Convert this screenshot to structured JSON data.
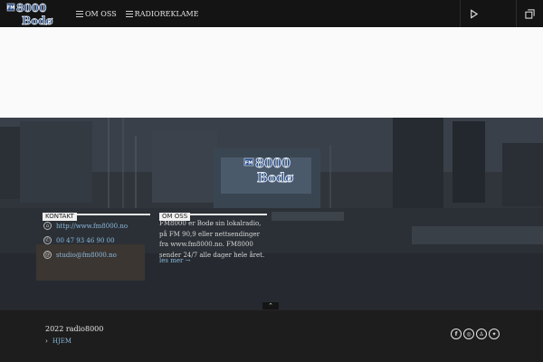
{
  "header": {
    "logo_top": "FM 8000",
    "logo_bottom": "Bodø",
    "nav": [
      {
        "label": "OM OSS"
      },
      {
        "label": "RADIOREKLAME"
      }
    ]
  },
  "hero": {
    "logo_top": "8000",
    "logo_bottom": "Bodø",
    "logo_badge": "FM",
    "contact_title": "KONTAKT",
    "contact": [
      {
        "icon": "home-icon",
        "glyph": "⌂",
        "text": "http://www.fm8000.no"
      },
      {
        "icon": "phone-icon",
        "glyph": "✆",
        "text": "00 47 93 46 90 00"
      },
      {
        "icon": "at-icon",
        "glyph": "@",
        "text": "studio@fm8000.no"
      }
    ],
    "about_title": "OM OSS",
    "about_text": "FM8000 er Bodø sin lokalradio, på FM 90,9 eller nettsendinger fra www.fm8000.no. FM8000 sender 24/7 alle dager hele året.",
    "read_more": "les mer →",
    "to_top": "⌃"
  },
  "footer": {
    "copyright": "2022 radio8000",
    "links": [
      {
        "chevron": "›",
        "label": "HJEM"
      }
    ],
    "social": [
      {
        "name": "facebook-icon",
        "glyph": "f"
      },
      {
        "name": "instagram-icon",
        "glyph": "◎"
      },
      {
        "name": "snapchat-icon",
        "glyph": "♙"
      },
      {
        "name": "twitter-icon",
        "glyph": "✦"
      }
    ]
  },
  "colors": {
    "header_bg": "#141414",
    "link": "#8ab8dc",
    "logo_blue": "#2a4f8c"
  }
}
